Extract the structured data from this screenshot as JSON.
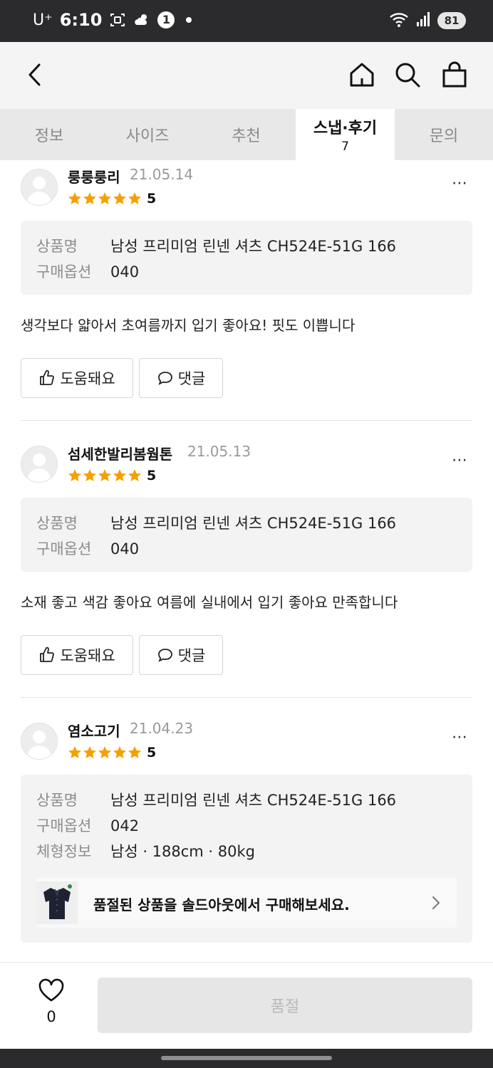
{
  "status_bar": {
    "carrier": "U⁺",
    "time": "6:10",
    "notification_badge": "1",
    "network": "6",
    "battery": "81"
  },
  "tabs": [
    {
      "label": "정보",
      "count": ""
    },
    {
      "label": "사이즈",
      "count": ""
    },
    {
      "label": "추천",
      "count": ""
    },
    {
      "label": "스냅·후기",
      "count": "7"
    },
    {
      "label": "문의",
      "count": ""
    }
  ],
  "active_tab": "스냅·후기",
  "labels": {
    "product_name": "상품명",
    "purchase_option": "구매옵션",
    "body_info": "체형정보",
    "helpful_button": "도움돼요",
    "comment_button": "댓글",
    "more": "⋯"
  },
  "reviews": [
    {
      "user": "룽룽룽리",
      "date": "21.05.14",
      "rating": 5,
      "rating_text": "5",
      "product": "남성 프리미엄 린넨 셔츠 CH524E-51G 166",
      "option": "040",
      "text": "생각보다 얇아서 초여름까지 입기 좋아요! 핏도 이쁩니다"
    },
    {
      "user": "섬세한발리봄웜톤",
      "date": "21.05.13",
      "rating": 5,
      "rating_text": "5",
      "product": "남성 프리미엄 린넨 셔츠 CH524E-51G 166",
      "option": "040",
      "text": "소재 좋고 색감 좋아요 여름에 실내에서 입기 좋아요 만족합니다"
    },
    {
      "user": "염소고기",
      "date": "21.04.23",
      "rating": 5,
      "rating_text": "5",
      "product": "남성 프리미엄 린넨 셔츠 CH524E-51G 166",
      "option": "042",
      "body": "남성 · 188cm · 80kg",
      "promo": "품절된 상품을 솔드아웃에서 구매해보세요."
    }
  ],
  "bottom": {
    "like_count": "0",
    "buy_button": "품절"
  },
  "colors": {
    "star": "#f5a000",
    "status_bar_bg": "#2b2b2d",
    "tab_bar_bg": "#e8e8e8",
    "info_box_bg": "#f3f3f3"
  }
}
